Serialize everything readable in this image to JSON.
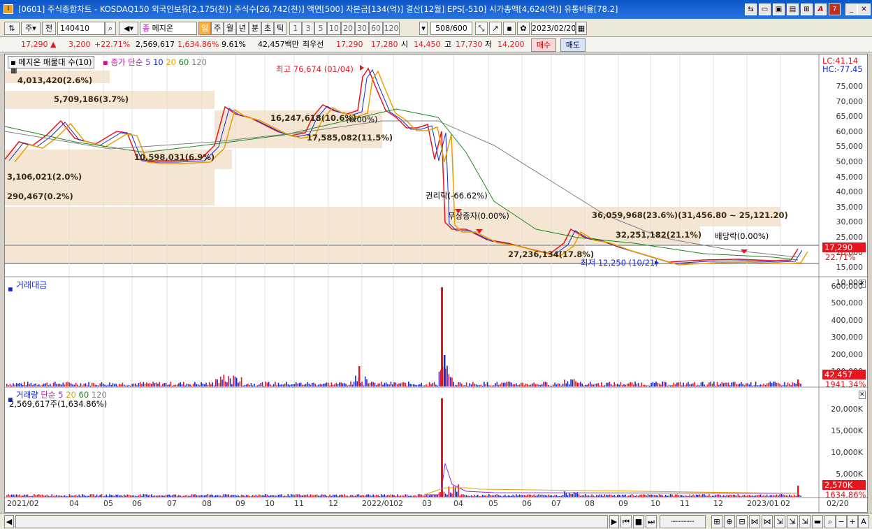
{
  "window": {
    "title": "[0601] 주식종합차트 - KOSDAQ150 외국인보유[2,175(천)] 주식수[26,742(천)] 액면[500] 자본금[134(억)] 결산[12월] EPS[-510] 시가총액[4,624(억)] 유통비율[78.2]"
  },
  "toolbar": {
    "type": "주",
    "prev": "전",
    "code": "140410",
    "name": "메지온",
    "periods": [
      "일",
      "주",
      "월",
      "년",
      "분",
      "초",
      "틱"
    ],
    "minutes": [
      "1",
      "3",
      "5",
      "10",
      "20",
      "30",
      "60",
      "120"
    ],
    "count": "508",
    "count_total": "/600",
    "date": "2023/02/20"
  },
  "quote": {
    "price": "17,290",
    "change": "3,200",
    "change_pct": "+22.71%",
    "volume": "2,569,617",
    "volume_pct": "1,634.86%",
    "turnover": "9.61%",
    "amount": "42,457백만",
    "best_label": "최우선",
    "ask": "17,290",
    "bid": "17,280",
    "open_label": "시",
    "open": "14,450",
    "high_label": "고",
    "high": "17,730",
    "low_label": "저",
    "low": "14,200",
    "buy": "매수",
    "sell": "매도"
  },
  "pane1": {
    "legend_a": "메지온 매물대 수(10)",
    "legend_b": "종가 단순",
    "ma": [
      "5",
      "10",
      "20",
      "60",
      "120"
    ],
    "lc": "LC:41.14",
    "hc": "HC:-77.45",
    "price_tag": "17,290",
    "pct_tag": "22.71%",
    "ticks": [
      "75,000",
      "70,000",
      "65,000",
      "60,000",
      "55,000",
      "50,000",
      "45,000",
      "40,000",
      "35,000",
      "30,000",
      "25,000",
      "20,000",
      "15,000",
      "10,000"
    ],
    "annotations": {
      "high": "최고 76,674 (01/04)",
      "low": "최저 12,250 (10/21)",
      "rights": "권리락(-66.62%)",
      "bonus": "무상증자(0.00%)",
      "dividend": "배당락(0.00%)",
      "zero": "(0.00%)"
    },
    "bands": [
      "4,013,420(2.6%)",
      "5,709,186(3.7%)",
      "16,247,618(10.6%)",
      "17,585,082(11.5%)",
      "10,598,031(6.9%)",
      "3,106,021(2.0%)",
      "290,467(0.2%)",
      "36,059,968(23.6%)(31,456.80 ~ 25,121.20)",
      "32,251,182(21.1%)",
      "27,236,134(17.8%)"
    ]
  },
  "pane2": {
    "title": "거래대금",
    "ticks": [
      "600,000",
      "500,000",
      "400,000",
      "300,000",
      "200,000",
      "100,000"
    ],
    "value_tag": "42,457",
    "pct_tag": "1941.34%"
  },
  "pane3": {
    "title": "거래량",
    "legend": "단순",
    "ma": [
      "5",
      "20",
      "60",
      "120"
    ],
    "sub": "2,569,617주(1,634.86%)",
    "ticks": [
      "20,000K",
      "15,000K",
      "10,000K",
      "5,000K"
    ],
    "value_tag": "2,570K",
    "pct_tag": "1634.86%"
  },
  "xaxis": [
    "2021/02",
    "04",
    "05",
    "06",
    "07",
    "08",
    "09",
    "10",
    "11",
    "12",
    "2022/01",
    "02",
    "03",
    "04",
    "05",
    "06",
    "07",
    "08",
    "09",
    "10",
    "11",
    "12",
    "2023/01",
    "02",
    "02/20"
  ],
  "colors": {
    "up": "#e8141e",
    "down": "#1428d8",
    "band": "#f5e6d3",
    "ma5": "#8a2be2",
    "ma20": "#e8a000",
    "ma60": "#1a8a1a",
    "ma120": "#808080"
  }
}
